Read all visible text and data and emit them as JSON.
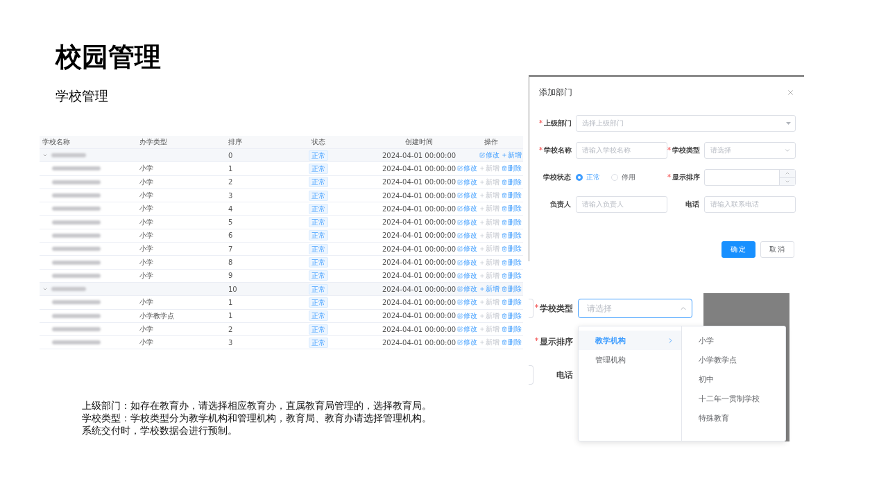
{
  "title": "校园管理",
  "subtitle": "学校管理",
  "table": {
    "columns": [
      "学校名称",
      "办学类型",
      "排序",
      "状态",
      "创建时间",
      "操作"
    ],
    "rows": [
      {
        "type": "",
        "order": "0",
        "status": "正常",
        "created": "2024-04-01 00:00:00",
        "expanded": true,
        "actions": [
          {
            "kind": "edit",
            "label": "修改",
            "disabled": false
          },
          {
            "kind": "add",
            "label": "新增",
            "disabled": false
          }
        ],
        "children": [
          {
            "type": "小学",
            "order": "1",
            "status": "正常",
            "created": "2024-04-01 00:00:00",
            "actions": [
              {
                "kind": "edit",
                "label": "修改",
                "disabled": false
              },
              {
                "kind": "add",
                "label": "新增",
                "disabled": true
              },
              {
                "kind": "delete",
                "label": "删除",
                "disabled": false
              }
            ]
          },
          {
            "type": "小学",
            "order": "2",
            "status": "正常",
            "created": "2024-04-01 00:00:00",
            "actions": [
              {
                "kind": "edit",
                "label": "修改",
                "disabled": false
              },
              {
                "kind": "add",
                "label": "新增",
                "disabled": true
              },
              {
                "kind": "delete",
                "label": "删除",
                "disabled": false
              }
            ]
          },
          {
            "type": "小学",
            "order": "3",
            "status": "正常",
            "created": "2024-04-01 00:00:00",
            "actions": [
              {
                "kind": "edit",
                "label": "修改",
                "disabled": false
              },
              {
                "kind": "add",
                "label": "新增",
                "disabled": true
              },
              {
                "kind": "delete",
                "label": "删除",
                "disabled": false
              }
            ]
          },
          {
            "type": "小学",
            "order": "4",
            "status": "正常",
            "created": "2024-04-01 00:00:00",
            "actions": [
              {
                "kind": "edit",
                "label": "修改",
                "disabled": false
              },
              {
                "kind": "add",
                "label": "新增",
                "disabled": true
              },
              {
                "kind": "delete",
                "label": "删除",
                "disabled": false
              }
            ]
          },
          {
            "type": "小学",
            "order": "5",
            "status": "正常",
            "created": "2024-04-01 00:00:00",
            "actions": [
              {
                "kind": "edit",
                "label": "修改",
                "disabled": false
              },
              {
                "kind": "add",
                "label": "新增",
                "disabled": true
              },
              {
                "kind": "delete",
                "label": "删除",
                "disabled": false
              }
            ]
          },
          {
            "type": "小学",
            "order": "6",
            "status": "正常",
            "created": "2024-04-01 00:00:00",
            "actions": [
              {
                "kind": "edit",
                "label": "修改",
                "disabled": false
              },
              {
                "kind": "add",
                "label": "新增",
                "disabled": true
              },
              {
                "kind": "delete",
                "label": "删除",
                "disabled": false
              }
            ]
          },
          {
            "type": "小学",
            "order": "7",
            "status": "正常",
            "created": "2024-04-01 00:00:00",
            "actions": [
              {
                "kind": "edit",
                "label": "修改",
                "disabled": false
              },
              {
                "kind": "add",
                "label": "新增",
                "disabled": true
              },
              {
                "kind": "delete",
                "label": "删除",
                "disabled": false
              }
            ]
          },
          {
            "type": "小学",
            "order": "8",
            "status": "正常",
            "created": "2024-04-01 00:00:00",
            "actions": [
              {
                "kind": "edit",
                "label": "修改",
                "disabled": false
              },
              {
                "kind": "add",
                "label": "新增",
                "disabled": true
              },
              {
                "kind": "delete",
                "label": "删除",
                "disabled": false
              }
            ]
          },
          {
            "type": "小学",
            "order": "9",
            "status": "正常",
            "created": "2024-04-01 00:00:00",
            "actions": [
              {
                "kind": "edit",
                "label": "修改",
                "disabled": false
              },
              {
                "kind": "add",
                "label": "新增",
                "disabled": true
              },
              {
                "kind": "delete",
                "label": "删除",
                "disabled": false
              }
            ]
          }
        ]
      },
      {
        "type": "",
        "order": "10",
        "status": "正常",
        "created": "2024-04-01 00:00:00",
        "expanded": true,
        "actions": [
          {
            "kind": "edit",
            "label": "修改",
            "disabled": false
          },
          {
            "kind": "add",
            "label": "新增",
            "disabled": false
          },
          {
            "kind": "delete",
            "label": "删除",
            "disabled": false
          }
        ],
        "children": [
          {
            "type": "小学",
            "order": "1",
            "status": "正常",
            "created": "2024-04-01 00:00:00",
            "actions": [
              {
                "kind": "edit",
                "label": "修改",
                "disabled": false
              },
              {
                "kind": "add",
                "label": "新增",
                "disabled": true
              },
              {
                "kind": "delete",
                "label": "删除",
                "disabled": false
              }
            ]
          },
          {
            "type": "小学教学点",
            "order": "1",
            "status": "正常",
            "created": "2024-04-01 00:00:00",
            "actions": [
              {
                "kind": "edit",
                "label": "修改",
                "disabled": false
              },
              {
                "kind": "add",
                "label": "新增",
                "disabled": true
              },
              {
                "kind": "delete",
                "label": "删除",
                "disabled": false
              }
            ]
          },
          {
            "type": "小学",
            "order": "2",
            "status": "正常",
            "created": "2024-04-01 00:00:00",
            "actions": [
              {
                "kind": "edit",
                "label": "修改",
                "disabled": false
              },
              {
                "kind": "add",
                "label": "新增",
                "disabled": true
              },
              {
                "kind": "delete",
                "label": "删除",
                "disabled": false
              }
            ]
          },
          {
            "type": "小学",
            "order": "3",
            "status": "正常",
            "created": "2024-04-01 00:00:00",
            "actions": [
              {
                "kind": "edit",
                "label": "修改",
                "disabled": false
              },
              {
                "kind": "add",
                "label": "新增",
                "disabled": true
              },
              {
                "kind": "delete",
                "label": "删除",
                "disabled": false
              }
            ]
          }
        ]
      }
    ]
  },
  "notes": [
    "上级部门：如存在教育办，请选择相应教育办，直属教育局管理的，选择教育局。",
    "学校类型：学校类型分为教学机构和管理机构，教育局、教育办请选择管理机构。",
    "系统交付时，学校数据会进行预制。"
  ],
  "dialog": {
    "title": "添加部门",
    "rows": [
      [
        {
          "kind": "tree-select",
          "label": "上级部门",
          "required": true,
          "placeholder": "选择上级部门"
        }
      ],
      [
        {
          "kind": "input",
          "label": "学校名称",
          "required": true,
          "placeholder": "请输入学校名称"
        },
        {
          "kind": "select",
          "label": "学校类型",
          "required": true,
          "placeholder": "请选择"
        }
      ],
      [
        {
          "kind": "radio",
          "label": "学校状态",
          "required": false,
          "options": [
            {
              "label": "正常",
              "selected": true
            },
            {
              "label": "停用",
              "selected": false
            }
          ]
        },
        {
          "kind": "number",
          "label": "显示排序",
          "required": true
        }
      ],
      [
        {
          "kind": "input",
          "label": "负责人",
          "required": false,
          "placeholder": "请输入负责人"
        },
        {
          "kind": "input",
          "label": "电话",
          "required": false,
          "placeholder": "请输入联系电话"
        }
      ]
    ],
    "buttons": [
      {
        "kind": "primary",
        "label": "确定"
      },
      {
        "kind": "default",
        "label": "取消"
      }
    ]
  },
  "cascader_preview": {
    "fields": [
      {
        "label": "学校类型",
        "required": true,
        "placeholder": "请选择",
        "open": true
      },
      {
        "label": "显示排序",
        "required": true
      },
      {
        "label": "电话",
        "required": false
      }
    ],
    "menu": [
      [
        {
          "label": "教学机构",
          "selected": true,
          "has_children": true
        },
        {
          "label": "管理机构",
          "selected": false,
          "has_children": false
        }
      ],
      [
        {
          "label": "小学",
          "selected": false
        },
        {
          "label": "小学教学点",
          "selected": false
        },
        {
          "label": "初中",
          "selected": false
        },
        {
          "label": "十二年一贯制学校",
          "selected": false
        },
        {
          "label": "特殊教育",
          "selected": false
        }
      ]
    ]
  }
}
